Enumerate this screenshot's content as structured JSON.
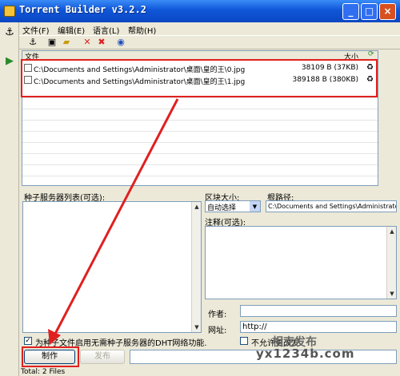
{
  "window": {
    "title": "Torrent Builder v3.2.2",
    "min": "_",
    "max": "□",
    "close": "×"
  },
  "menu": [
    "文件(F)",
    "编辑(E)",
    "语言(L)",
    "帮助(H)"
  ],
  "toolbar_icons": [
    "anchor-icon",
    "new-icon",
    "open-folder-icon",
    "remove-icon",
    "clear-icon",
    "help-icon"
  ],
  "file_list": {
    "col_name": "文件",
    "col_size": "大小",
    "rows": [
      {
        "path": "C:\\Documents and Settings\\Administrator\\桌面\\皇的王\\0.jpg",
        "size": "38109 B (37KB)"
      },
      {
        "path": "C:\\Documents and Settings\\Administrator\\桌面\\皇的王\\1.jpg",
        "size": "389188 B (380KB)"
      }
    ]
  },
  "trackers_label": "种子服务器列表(可选):",
  "block_size_label": "区块大小:",
  "block_size_value": "自动选择",
  "root_path_label": "根路径:",
  "root_path_value": "C:\\Documents and Settings\\Administrator\\",
  "comment_label": "注释(可选):",
  "author_label": "作者:",
  "url_label": "网址:",
  "url_value": "http://",
  "no_change_label": "不允许更改发",
  "dht_label": "为种子文件启用无需种子服务器的DHT网络功能.",
  "make_button": "制作",
  "publish_button": "发布",
  "status": "Total: 2 Files",
  "watermark": "yx1234b.com",
  "watermark2": "相克发布",
  "colors": {
    "titlebar": "#0f56d8",
    "highlight": "#e02020"
  }
}
